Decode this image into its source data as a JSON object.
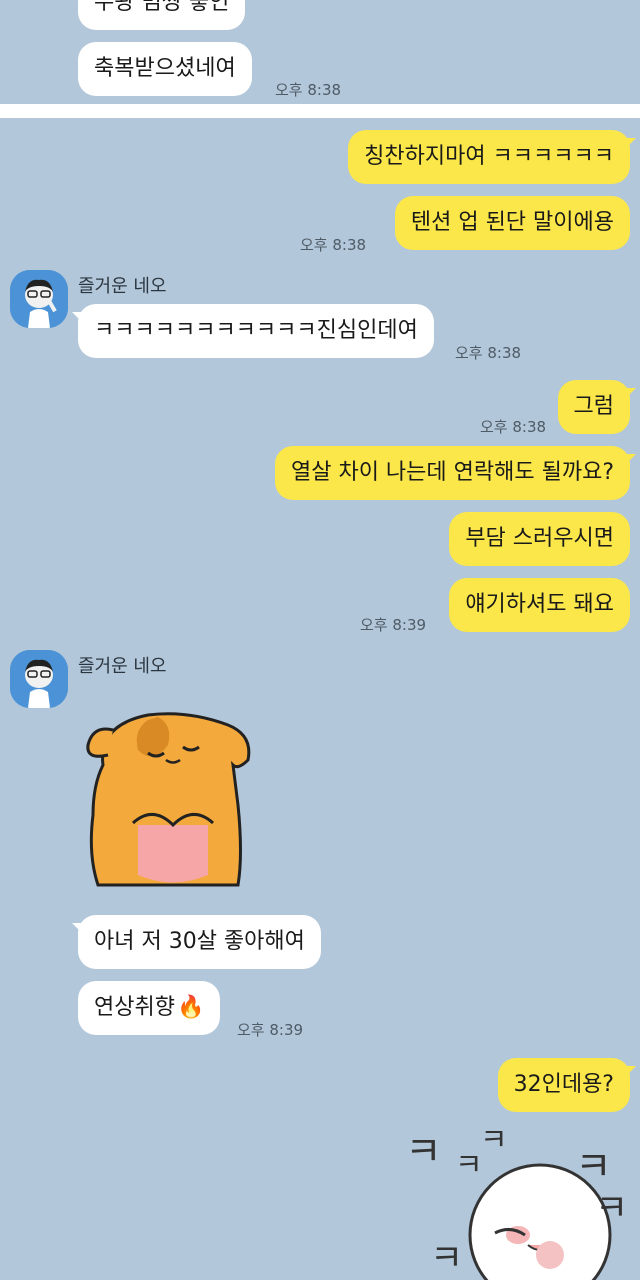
{
  "chat": {
    "cut_off_top_message": "우왕 멈짱 좋인",
    "messages_top": {
      "blessed": "축복받으셨네여",
      "blessed_time": "오후 8:38"
    },
    "out1": {
      "text": "칭찬하지마여 ㅋㅋㅋㅋㅋㅋ",
      "text2": "텐션 업 된단 말이에용",
      "time": "오후 8:38"
    },
    "sender_name": "즐거운 네오",
    "in1": {
      "text": "ㅋㅋㅋㅋㅋㅋㅋㅋㅋㅋㅋ진심인데여",
      "time": "오후 8:38"
    },
    "out2": {
      "text": "그럼",
      "time": "오후 8:38"
    },
    "out3": {
      "text1": "열살 차이 나는데 연락해도 될까요?",
      "text2": "부담 스러우시면",
      "text3": "얘기하셔도 돼요",
      "time": "오후 8:39"
    },
    "sender_name_2": "즐거운 네오",
    "in2": {
      "sticker_icon": "dog-hug-sticker",
      "text1": "아녀 저 30살 좋아해여",
      "text2": "연상취향",
      "fire_emoji": "🔥",
      "time": "오후 8:39"
    },
    "out4": {
      "text": "32인데용?",
      "sticker_icon": "laughing-chick-sticker"
    }
  },
  "colors": {
    "background": "#b2c7d9",
    "outgoing_bubble": "#fbe74a",
    "incoming_bubble": "#ffffff",
    "avatar_bg": "#4b93d6"
  }
}
